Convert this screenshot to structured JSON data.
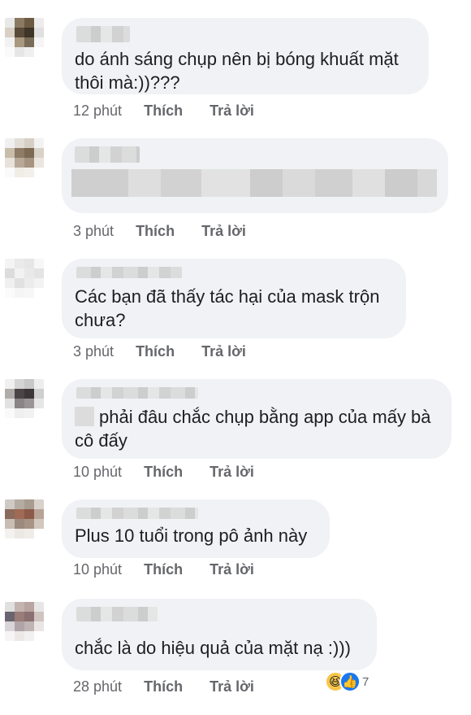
{
  "comments": [
    {
      "text_line1": "do ánh sáng chụp nên bị bóng khuất mặt",
      "text_line2": "thôi mà:))???",
      "time": "12 phút",
      "like": "Thích",
      "reply": "Trả lời"
    },
    {
      "text_line1": "",
      "text_line2": "",
      "time": "3 phút",
      "like": "Thích",
      "reply": "Trả lời"
    },
    {
      "text_line1": "Các bạn đã thấy tác hại của mask trộn",
      "text_line2": "chưa?",
      "time": "3 phút",
      "like": "Thích",
      "reply": "Trả lời"
    },
    {
      "text_line1": "phải đâu chắc chụp bằng app của mấy bà",
      "text_line2": "cô đấy",
      "time": "10 phút",
      "like": "Thích",
      "reply": "Trả lời"
    },
    {
      "text_line1": "Plus 10 tuổi trong pô ảnh này",
      "text_line2": "",
      "time": "10 phút",
      "like": "Thích",
      "reply": "Trả lời"
    },
    {
      "text_line1": "chắc là do hiệu quả của mặt nạ :)))",
      "text_line2": "",
      "time": "28 phút",
      "like": "Thích",
      "reply": "Trả lời"
    }
  ],
  "reactions": {
    "count": "7",
    "icons": [
      "haha-icon",
      "like-icon"
    ]
  },
  "colors": {
    "bubble": "#f0f2f5",
    "meta": "#65676b",
    "like_blue": "#1877f2",
    "haha_yellow": "#f7c64a"
  }
}
